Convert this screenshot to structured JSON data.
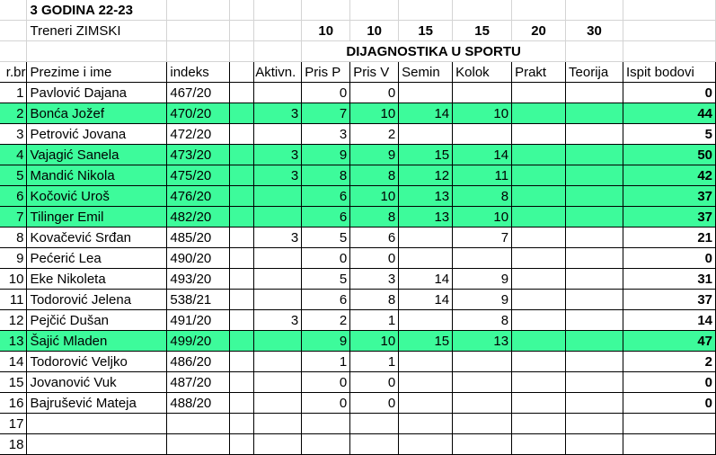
{
  "sheet": {
    "title": "3 GODINA 22-23",
    "subtitle": "Treneri ZIMSKI",
    "max_points": [
      "10",
      "10",
      "15",
      "15",
      "20",
      "30"
    ],
    "section_title": "DIJAGNOSTIKA U SPORTU",
    "headers": [
      "r.br",
      "Prezime i ime",
      "indeks",
      "Aktivn.",
      "Pris P",
      "Pris V",
      "Semin",
      "Kolok",
      "Prakt",
      "Teorija",
      "Ispit bodovi"
    ],
    "highlight_color": "#3dfb9b",
    "rows": [
      {
        "n": "1",
        "name": "Pavlović Dajana",
        "idx": "467/20",
        "akt": "",
        "pp": "0",
        "pv": "0",
        "sem": "",
        "kol": "",
        "prakt": "",
        "teo": "",
        "total": "0",
        "hl": false
      },
      {
        "n": "2",
        "name": "Bonća Jožef",
        "idx": "470/20",
        "akt": "3",
        "pp": "7",
        "pv": "10",
        "sem": "14",
        "kol": "10",
        "prakt": "",
        "teo": "",
        "total": "44",
        "hl": true
      },
      {
        "n": "3",
        "name": "Petrović Jovana",
        "idx": "472/20",
        "akt": "",
        "pp": "3",
        "pv": "2",
        "sem": "",
        "kol": "",
        "prakt": "",
        "teo": "",
        "total": "5",
        "hl": false
      },
      {
        "n": "4",
        "name": "Vajagić Sanela",
        "idx": "473/20",
        "akt": "3",
        "pp": "9",
        "pv": "9",
        "sem": "15",
        "kol": "14",
        "prakt": "",
        "teo": "",
        "total": "50",
        "hl": true
      },
      {
        "n": "5",
        "name": "Mandić Nikola",
        "idx": "475/20",
        "akt": "3",
        "pp": "8",
        "pv": "8",
        "sem": "12",
        "kol": "11",
        "prakt": "",
        "teo": "",
        "total": "42",
        "hl": true
      },
      {
        "n": "6",
        "name": "Kočović Uroš",
        "idx": "476/20",
        "akt": "",
        "pp": "6",
        "pv": "10",
        "sem": "13",
        "kol": "8",
        "prakt": "",
        "teo": "",
        "total": "37",
        "hl": true
      },
      {
        "n": "7",
        "name": "Tilinger Emil",
        "idx": "482/20",
        "akt": "",
        "pp": "6",
        "pv": "8",
        "sem": "13",
        "kol": "10",
        "prakt": "",
        "teo": "",
        "total": "37",
        "hl": true
      },
      {
        "n": "8",
        "name": "Kovačević Srđan",
        "idx": "485/20",
        "akt": "3",
        "pp": "5",
        "pv": "6",
        "sem": "",
        "kol": "7",
        "prakt": "",
        "teo": "",
        "total": "21",
        "hl": false
      },
      {
        "n": "9",
        "name": "Pećerić Lea",
        "idx": "490/20",
        "akt": "",
        "pp": "0",
        "pv": "0",
        "sem": "",
        "kol": "",
        "prakt": "",
        "teo": "",
        "total": "0",
        "hl": false
      },
      {
        "n": "10",
        "name": "Eke Nikoleta",
        "idx": "493/20",
        "akt": "",
        "pp": "5",
        "pv": "3",
        "sem": "14",
        "kol": "9",
        "prakt": "",
        "teo": "",
        "total": "31",
        "hl": false
      },
      {
        "n": "11",
        "name": "Todorović Jelena",
        "idx": "538/21",
        "akt": "",
        "pp": "6",
        "pv": "8",
        "sem": "14",
        "kol": "9",
        "prakt": "",
        "teo": "",
        "total": "37",
        "hl": false
      },
      {
        "n": "12",
        "name": "Pejčić Dušan",
        "idx": "491/20",
        "akt": "3",
        "pp": "2",
        "pv": "1",
        "sem": "",
        "kol": "8",
        "prakt": "",
        "teo": "",
        "total": "14",
        "hl": false
      },
      {
        "n": "13",
        "name": "Šajić Mladen",
        "idx": "499/20",
        "akt": "",
        "pp": "9",
        "pv": "10",
        "sem": "15",
        "kol": "13",
        "prakt": "",
        "teo": "",
        "total": "47",
        "hl": true
      },
      {
        "n": "14",
        "name": "Todorović Veljko",
        "idx": "486/20",
        "akt": "",
        "pp": "1",
        "pv": "1",
        "sem": "",
        "kol": "",
        "prakt": "",
        "teo": "",
        "total": "2",
        "hl": false
      },
      {
        "n": "15",
        "name": "Jovanović Vuk",
        "idx": "487/20",
        "akt": "",
        "pp": "0",
        "pv": "0",
        "sem": "",
        "kol": "",
        "prakt": "",
        "teo": "",
        "total": "0",
        "hl": false
      },
      {
        "n": "16",
        "name": "Bajrušević Mateja",
        "idx": "488/20",
        "akt": "",
        "pp": "0",
        "pv": "0",
        "sem": "",
        "kol": "",
        "prakt": "",
        "teo": "",
        "total": "0",
        "hl": false
      },
      {
        "n": "17",
        "name": "",
        "idx": "",
        "akt": "",
        "pp": "",
        "pv": "",
        "sem": "",
        "kol": "",
        "prakt": "",
        "teo": "",
        "total": "",
        "hl": false
      },
      {
        "n": "18",
        "name": "",
        "idx": "",
        "akt": "",
        "pp": "",
        "pv": "",
        "sem": "",
        "kol": "",
        "prakt": "",
        "teo": "",
        "total": "",
        "hl": false
      }
    ]
  }
}
